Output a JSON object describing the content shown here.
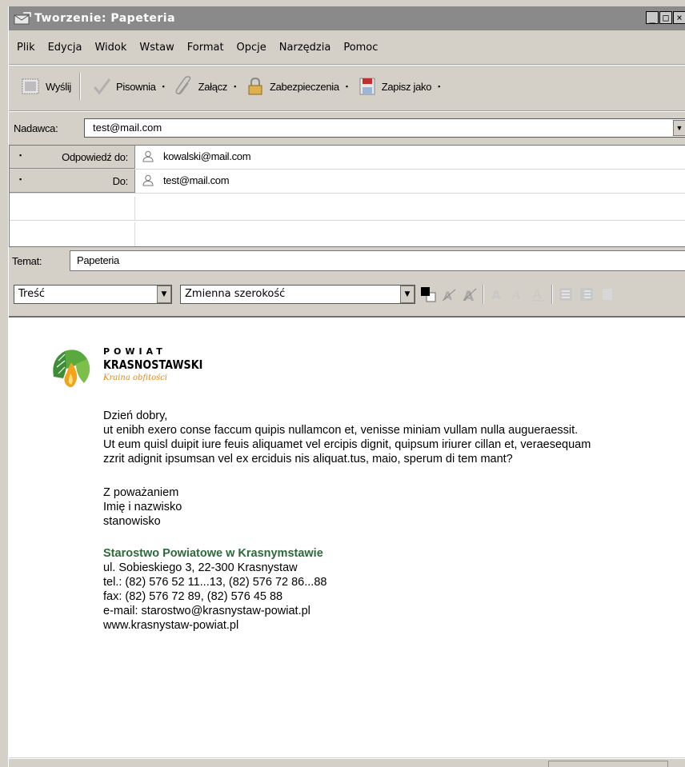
{
  "window": {
    "title": "Tworzenie: Papeteria",
    "minimize": "_",
    "maximize": "□",
    "close": "×"
  },
  "menu": [
    "Plik",
    "Edycja",
    "Widok",
    "Wstaw",
    "Format",
    "Opcje",
    "Narzędzia",
    "Pomoc"
  ],
  "toolbar": {
    "send": "Wyślij",
    "spelling": "Pisownia",
    "attach": "Załącz",
    "security": "Zabezpieczenia",
    "save_as": "Zapisz jako",
    "dropdown_arrow": "▪"
  },
  "sender": {
    "label": "Nadawca:",
    "value": "test@mail.com"
  },
  "recipients": [
    {
      "type": "Odpowiedź do:",
      "address": "kowalski@mail.com"
    },
    {
      "type": "Do:",
      "address": "test@mail.com"
    }
  ],
  "subject": {
    "label": "Temat:",
    "value": "Papeteria"
  },
  "format_bar": {
    "paragraph_style": "Treść",
    "font": "Zmienna szerokość",
    "text_color": "#000000"
  },
  "signature_logo": {
    "line1": "POWIAT",
    "line2": "KRASNOSTAWSKI",
    "tagline": "Kraina obfitości",
    "leaf_color": "#4b9a3c",
    "flame_color": "#f2a31b"
  },
  "message": {
    "greeting": "Dzień dobry,",
    "lines": [
      "ut enibh exero conse faccum quipis nullamcon et, venisse miniam vullam nulla augueraessit.",
      "Ut eum quisl duipit iure feuis aliquamet vel ercipis dignit, quipsum iriurer cillan et, veraesequam",
      "zzrit adignit ipsumsan vel ex erciduis nis aliquat.tus, maio, sperum di tem mant?"
    ],
    "closing": [
      "Z poważaniem",
      "Imię i nazwisko",
      "stanowisko"
    ]
  },
  "organization": {
    "name": "Starostwo Powiatowe w Krasnymstawie",
    "name_color": "#2d6a3a",
    "address": "ul. Sobieskiego 3, 22-300 Krasnystaw",
    "tel": "tel.: (82) 576 52 11...13, (82) 576 72 86...88",
    "fax": "fax: (82) 576 72 89, (82) 576 45 88",
    "email": "e-mail: starostwo@krasnystaw-powiat.pl",
    "www": "www.krasnystaw-powiat.pl"
  }
}
